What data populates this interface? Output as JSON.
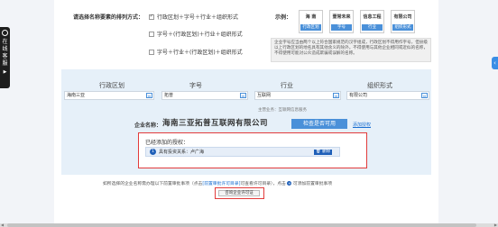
{
  "sidebar_left": {
    "labels": [
      "在",
      "线",
      "客",
      "服"
    ],
    "arrow": "▶"
  },
  "sidebar_right": {
    "arrow": "‹"
  },
  "order": {
    "label": "请选择名称要素的排列方式：",
    "options": [
      {
        "label": "行政区划＋字号＋行业＋组织形式",
        "checked": true
      },
      {
        "label": "字号＋(行政区划)＋行业＋组织形式",
        "checked": false
      },
      {
        "label": "字号＋行业＋(行政区划)＋组织形式",
        "checked": false
      }
    ]
  },
  "example": {
    "label": "示例：",
    "boxes": [
      {
        "big": "海  南",
        "tag": "行政区划"
      },
      {
        "big": "壹常未来",
        "tag": "字号"
      },
      {
        "big": "信息工程",
        "tag": "行业"
      },
      {
        "big": "有限公司",
        "tag": "组织形式"
      }
    ],
    "tip": "企业字号应当由两个以上符合国家规范的汉字组成，行政区划不得用作字号，但县级以上行政区划的地名具有其他含义的除外。不得使用与其他企业相同或近似的名称，不得使用可能对公众造成欺骗或误解的名称。"
  },
  "panel": {
    "headers": [
      "行政区划",
      "字号",
      "行业",
      "组织形式"
    ],
    "fields": [
      "海南三亚",
      "拓普",
      "互联网",
      "有限公司"
    ],
    "industry_note": "主营业务：互联网信息服务",
    "company_label": "企业名称：",
    "company_name": "海南三亚拓普互联网有限公司",
    "check_button": "检查是否可用",
    "add_link": "添加授权",
    "auth": {
      "title": "已经添加的授权：",
      "items": [
        {
          "num": "1",
          "text": "具有投资关系：卢广海",
          "delete": "删除"
        }
      ]
    }
  },
  "bottom": {
    "text_before": "如所选择的企业名称需办理以下前置审批事项（点击",
    "link": "[前置审批许可目录]",
    "text_middle": "可查看许可目录），点击",
    "plus": "+",
    "text_after": "可添加前置审批事项",
    "consult_button": "咨询企业许可证"
  }
}
